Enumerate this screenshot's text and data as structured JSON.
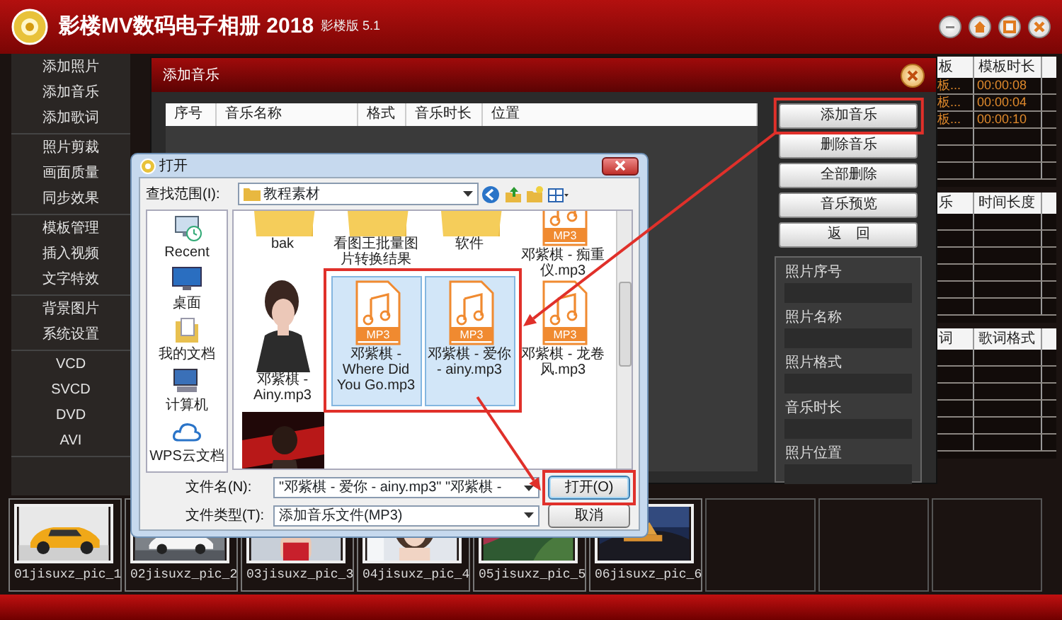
{
  "app": {
    "title": "影楼MV数码电子相册 2018",
    "edition": "影楼版 5.1"
  },
  "sidebar": {
    "groups": [
      {
        "items": [
          "添加照片",
          "添加音乐",
          "添加歌词"
        ]
      },
      {
        "items": [
          "照片剪裁",
          "画面质量",
          "同步效果"
        ]
      },
      {
        "items": [
          "模板管理",
          "插入视频",
          "文字特效"
        ]
      },
      {
        "items": [
          "背景图片",
          "系统设置"
        ]
      },
      {
        "items": [
          "VCD",
          "SVCD",
          "DVD",
          "AVI"
        ]
      }
    ]
  },
  "template_table": {
    "columns": [
      "板",
      "模板时长"
    ],
    "rows": [
      [
        "板...",
        "00:00:08"
      ],
      [
        "板...",
        "00:00:04"
      ],
      [
        "板...",
        "00:00:10"
      ]
    ]
  },
  "music_table": {
    "columns": [
      "乐",
      "时间长度"
    ]
  },
  "lyrics_table": {
    "columns": [
      "词",
      "歌词格式"
    ]
  },
  "thumbnails": [
    {
      "caption": "01jisuxz_pic_1",
      "kind": "picture"
    },
    {
      "caption": "02jisuxz_pic_2",
      "kind": "picture"
    },
    {
      "caption": "03jisuxz_pic_3",
      "kind": "picture"
    },
    {
      "caption": "04jisuxz_pic_4",
      "kind": "picture"
    },
    {
      "caption": "05jisuxz_pic_5",
      "kind": "picture"
    },
    {
      "caption": "06jisuxz_pic_6",
      "kind": "picture"
    }
  ],
  "add_music_dialog": {
    "title": "添加音乐",
    "columns": [
      "序号",
      "音乐名称",
      "格式",
      "音乐时长",
      "位置"
    ],
    "buttons": [
      {
        "label": "添加音乐",
        "highlighted": true
      },
      {
        "label": "删除音乐",
        "highlighted": false
      },
      {
        "label": "全部删除",
        "highlighted": false
      },
      {
        "label": "音乐预览",
        "highlighted": false
      },
      {
        "label": "返　回",
        "highlighted": false
      }
    ],
    "info_fields": [
      "照片序号",
      "照片名称",
      "照片格式",
      "音乐时长",
      "照片位置"
    ]
  },
  "open_dialog": {
    "title": "打开",
    "look_in_label": "查找范围(I):",
    "look_in_value": "教程素材",
    "places": [
      "Recent",
      "桌面",
      "我的文档",
      "计算机",
      "WPS云文档"
    ],
    "files": [
      {
        "name": "bak",
        "kind": "folder",
        "selected": false
      },
      {
        "name": "看图王批量图片转换结果",
        "kind": "folder",
        "selected": false
      },
      {
        "name": "软件",
        "kind": "folder",
        "selected": false
      },
      {
        "name": "邓紫棋 - 痴重仪.mp3",
        "kind": "audio",
        "icon_label": "MP3",
        "selected": false
      },
      {
        "name": "邓紫棋 - Ainy.mp3",
        "kind": "album-art",
        "selected": false
      },
      {
        "name": "邓紫棋 - Where Did You Go.mp3",
        "kind": "audio",
        "icon_label": "MP3",
        "selected": true
      },
      {
        "name": "邓紫棋 - 爱你 - ainy.mp3",
        "kind": "audio",
        "icon_label": "MP3",
        "selected": true
      },
      {
        "name": "邓紫棋 - 龙卷风.mp3",
        "kind": "audio",
        "icon_label": "MP3",
        "selected": false
      },
      {
        "kind": "album-art",
        "selected": false
      }
    ],
    "file_name_label": "文件名(N):",
    "file_name_value": "\"邓紫棋 - 爱你 - ainy.mp3\" \"邓紫棋 - ",
    "file_type_label": "文件类型(T):",
    "file_type_value": "添加音乐文件(MP3)",
    "buttons": [
      {
        "label": "打开(O)",
        "highlighted": true
      },
      {
        "label": "取消",
        "highlighted": false
      }
    ]
  }
}
